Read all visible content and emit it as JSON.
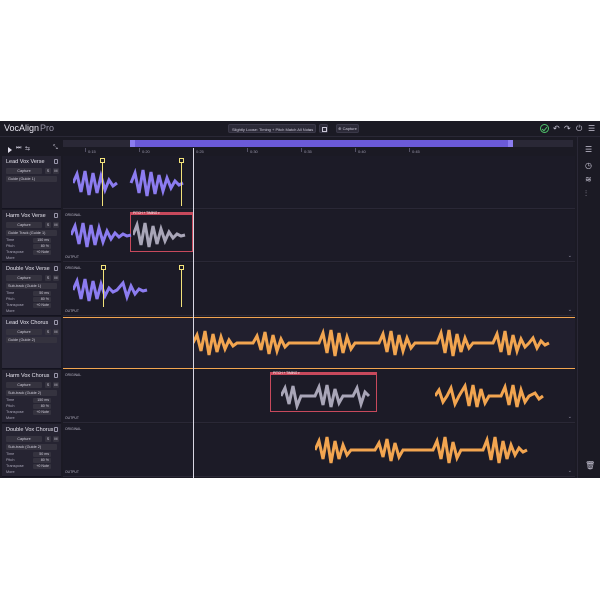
{
  "app": {
    "name": "VocAlign",
    "edition": "Pro"
  },
  "toolbar": {
    "preset": "Slightly Loose: Timing + Pitch Match All Notes",
    "preset_chevron": "⌄",
    "capture": "⊕ Capture"
  },
  "ruler": {
    "ticks": [
      "0:15",
      "0:20",
      "0:25",
      "0:30",
      "0:35",
      "0:40",
      "0:45"
    ]
  },
  "colors": {
    "verse_wave": "#8c7cf0",
    "chorus_wave": "#f2a550",
    "original_wave": "#a9a6b8",
    "pitch_box": "#c7495c",
    "accent": "#6b5ad8"
  },
  "tracks": [
    {
      "name": "Lead Vox Verse",
      "capture": "Capture",
      "s": "S",
      "m": "M",
      "guide": "Guide (Guide 1)"
    },
    {
      "name": "Harm Vox Verse",
      "capture": "Capture",
      "s": "S",
      "m": "M",
      "guide": "Guide Track (Guide 1)",
      "time_label": "Time",
      "time_val": "150 ms",
      "pitch_label": "Pitch",
      "pitch_val": "80 %",
      "transpose_label": "Transpose",
      "transpose_val": "+0 Note",
      "more": "More",
      "original": "ORIGINAL",
      "output": "OUTPUT",
      "pitch_timing": "PITCH + TIMING ▾"
    },
    {
      "name": "Double Vox Verse",
      "capture": "Capture",
      "s": "S",
      "m": "M",
      "guide": "Sub-track (Guide 1)",
      "time_label": "Time",
      "time_val": "50 ms",
      "pitch_label": "Pitch",
      "pitch_val": "80 %",
      "transpose_label": "Transpose",
      "transpose_val": "+0 Note",
      "more": "More",
      "original": "ORIGINAL",
      "output": "OUTPUT"
    },
    {
      "name": "Lead Vox Chorus",
      "capture": "Capture",
      "s": "S",
      "m": "M",
      "guide": "Guide (Guide 2)"
    },
    {
      "name": "Harm Vox Chorus",
      "capture": "Capture",
      "s": "S",
      "m": "M",
      "guide": "Sub-track (Guide 2)",
      "time_label": "Time",
      "time_val": "150 ms",
      "pitch_label": "Pitch",
      "pitch_val": "80 %",
      "transpose_label": "Transpose",
      "transpose_val": "+0 Note",
      "more": "More",
      "original": "ORIGINAL",
      "output": "OUTPUT",
      "pitch_timing": "PITCH + TIMING ▾"
    },
    {
      "name": "Double Vox Chorus",
      "capture": "Capture",
      "s": "S",
      "m": "M",
      "guide": "Sub-track (Guide 2)",
      "time_label": "Time",
      "time_val": "50 ms",
      "pitch_label": "Pitch",
      "pitch_val": "80 %",
      "transpose_label": "Transpose",
      "transpose_val": "+0 Note",
      "more": "More",
      "original": "ORIGINAL",
      "output": "OUTPUT"
    }
  ]
}
